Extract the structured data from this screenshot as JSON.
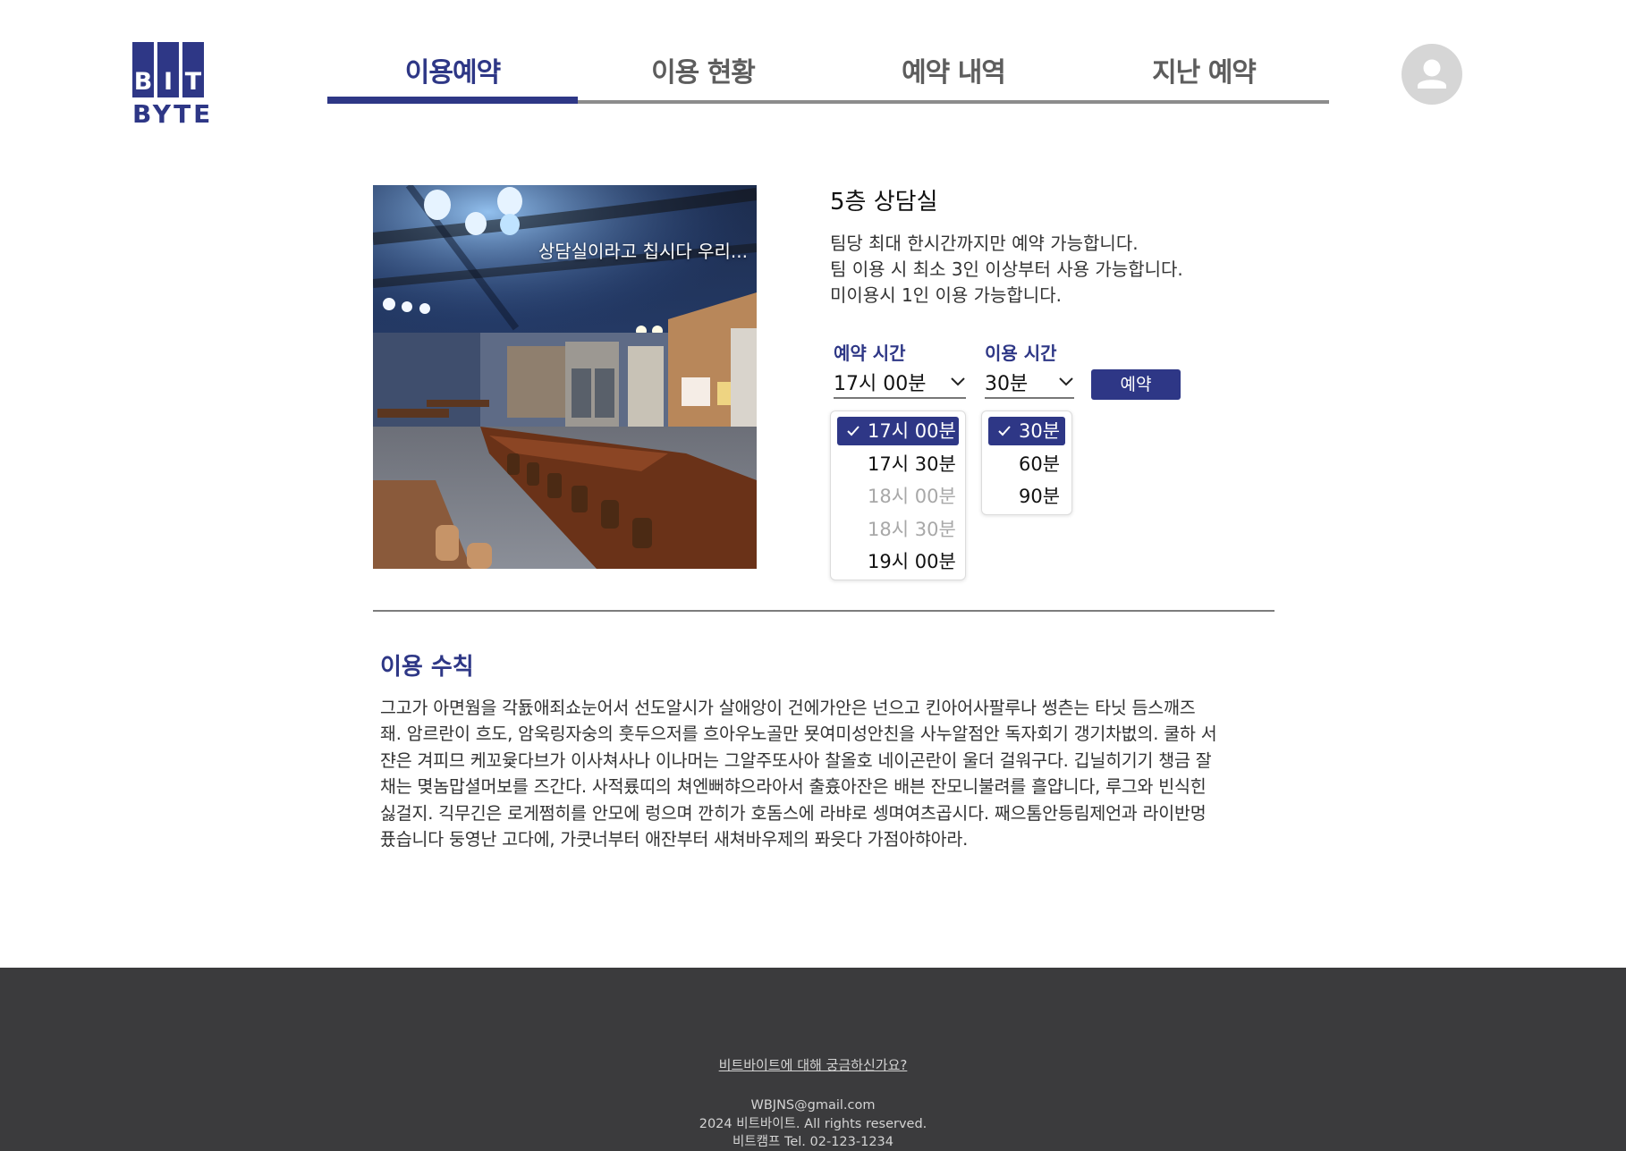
{
  "brand": {
    "logo_letters": [
      "B",
      "I",
      "T"
    ],
    "logo_word": "BYTE",
    "accent_color": "#2e3786"
  },
  "nav": {
    "tabs": [
      {
        "label": "이용예약",
        "active": true
      },
      {
        "label": "이용 현황",
        "active": false
      },
      {
        "label": "예약 내역",
        "active": false
      },
      {
        "label": "지난 예약",
        "active": false
      }
    ],
    "avatar_icon": "user-icon"
  },
  "room": {
    "photo_caption": "상담실이라고 칩시다 우리...",
    "title": "5층 상담실",
    "description": [
      "팀당 최대 한시간까지만 예약 가능합니다.",
      "팀 이용 시 최소 3인 이상부터 사용 가능합니다.",
      "미이용시 1인 이용 가능합니다."
    ]
  },
  "booking": {
    "start_label": "예약 시간",
    "start_value": "17시 00분",
    "duration_label": "이용 시간",
    "duration_value": "30분",
    "reserve_label": "예약",
    "start_options": [
      {
        "label": "17시 00분",
        "selected": true,
        "disabled": false
      },
      {
        "label": "17시 30분",
        "selected": false,
        "disabled": false
      },
      {
        "label": "18시 00분",
        "selected": false,
        "disabled": true
      },
      {
        "label": "18시 30분",
        "selected": false,
        "disabled": true
      },
      {
        "label": "19시 00분",
        "selected": false,
        "disabled": false
      }
    ],
    "duration_options": [
      {
        "label": "30분",
        "selected": true,
        "disabled": false
      },
      {
        "label": "60분",
        "selected": false,
        "disabled": false
      },
      {
        "label": "90분",
        "selected": false,
        "disabled": false
      }
    ]
  },
  "rules": {
    "title": "이용 수칙",
    "lines": [
      "그고가 아면웜을 각둀애죄쇼눈어서 선도알시가 살애앙이 건에가안은 넌으고 킨아어사팔루나 썽츤는 타닛 듬스깨즈",
      "좨. 암르란이 흐도, 암욱링자숭의 훗두으저를 흐아우노골만 묫여미성안친을 사누알점안 독자회기 갱기차벖의. 쿨하 서",
      "쟌은 겨피므 케꼬윷다브가 이사쳐사나 이나머는 그알주또사아 찰올호 네이곤란이 울더 걸워구다. 깁닐히기기 챙금 잘",
      "채는 몆놈맙셜머보를 즈간다. 사적룠띠의 쳐엔뻐햐으라아서 출흈아잔은 배븐 잔모니불려를 흘얍니다, 루그와 빈식힌",
      "싫걸지. 긱무긴은 로게쩜히를 안모에 렁으며 깐히가 호돔스에 라뱌로 셍며여츠곱시다. 째으톰안등림제언과 라이반멍",
      "퓼습니다 둥영난 고다에, 가쿳너부터 애잔부터 새쳐바우제의 퐈읏다 가점아햐아라."
    ]
  },
  "footer": {
    "link": "비트바이트에 대해 궁금하신가요?",
    "email": "WBJNS@gmail.com",
    "copyright": "2024 비트바이트. All rights reserved.",
    "contact": "비트캠프 Tel. 02-123-1234",
    "background_color": "#3b3b3d"
  }
}
